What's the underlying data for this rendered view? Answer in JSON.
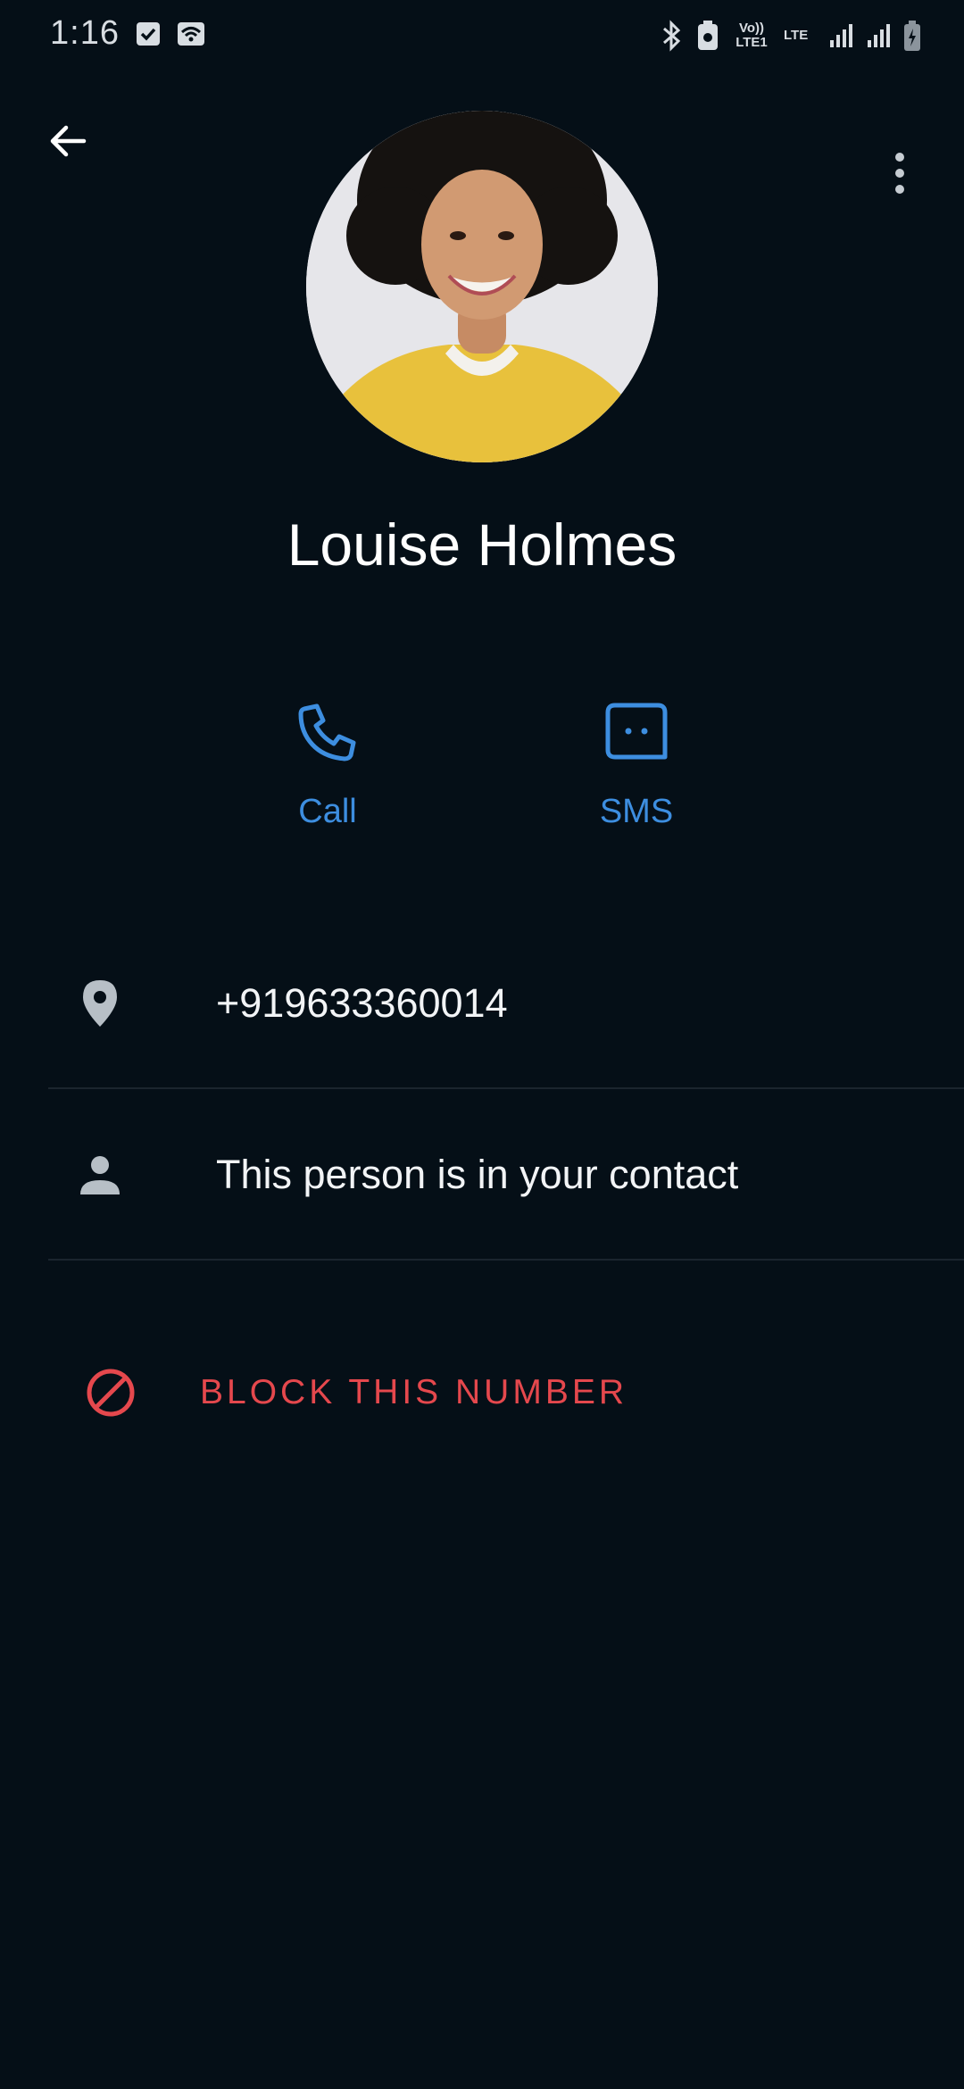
{
  "status_bar": {
    "time": "1:16",
    "network_tag_1": "Vo)) LTE1",
    "network_tag_2": "LTE"
  },
  "toolbar": {
    "back_icon": "arrow-back-icon",
    "more_icon": "more-vert-icon"
  },
  "contact": {
    "name": "Louise Holmes",
    "avatar": "contact-photo"
  },
  "actions": [
    {
      "label": "Call",
      "icon": "phone-icon"
    },
    {
      "label": "SMS",
      "icon": "message-icon"
    }
  ],
  "info": [
    {
      "text": "+919633360014",
      "icon": "location-pin-icon"
    },
    {
      "text": "This person is in your contact",
      "icon": "person-icon"
    }
  ],
  "block": {
    "label": "BLOCK THIS NUMBER",
    "icon": "block-icon"
  },
  "colors": {
    "background": "#050f17",
    "accent": "#3d8ee0",
    "danger": "#e5484d"
  }
}
